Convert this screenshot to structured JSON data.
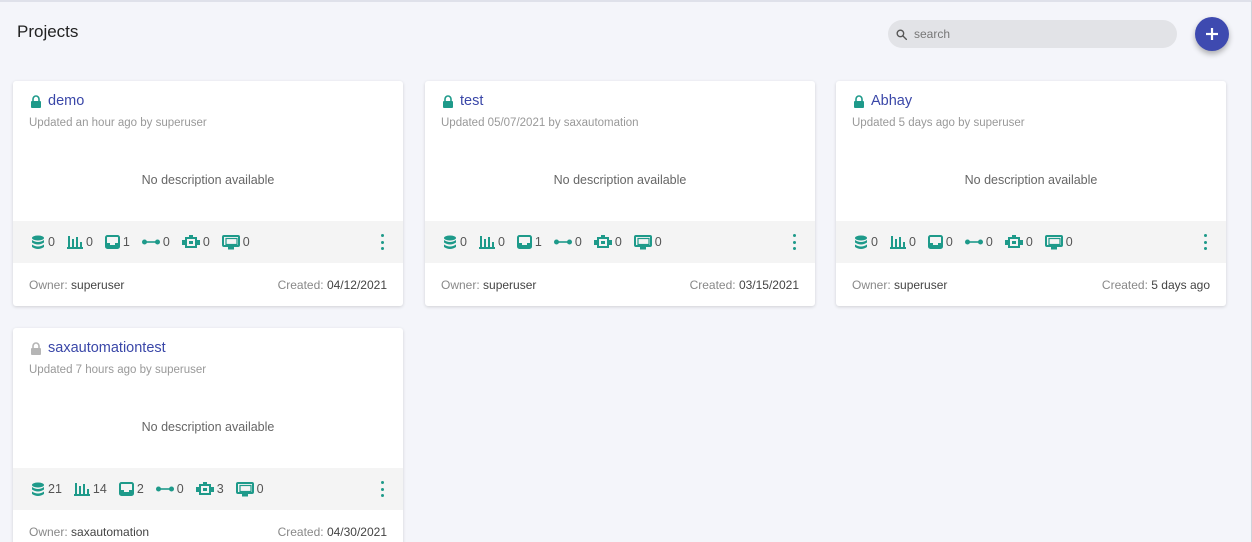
{
  "header": {
    "title": "Projects",
    "search_placeholder": "search"
  },
  "colors": {
    "accent": "#1e9a8a",
    "link": "#3a47a8",
    "add_button": "#3e4ab0",
    "lock_locked": "#1e9a8a",
    "lock_unlocked": "#b5b5b5"
  },
  "labels": {
    "no_description": "No description available",
    "owner": "Owner:",
    "created": "Created:"
  },
  "projects": [
    {
      "name": "demo",
      "lock": "locked",
      "updated": "Updated an hour ago by superuser",
      "description": "No description available",
      "stats": {
        "datasets": "0",
        "charts": "0",
        "inbox": "1",
        "pipelines": "0",
        "engines": "0",
        "dashboards": "0"
      },
      "owner": "superuser",
      "created": "04/12/2021"
    },
    {
      "name": "test",
      "lock": "locked",
      "updated": "Updated 05/07/2021 by saxautomation",
      "description": "No description available",
      "stats": {
        "datasets": "0",
        "charts": "0",
        "inbox": "1",
        "pipelines": "0",
        "engines": "0",
        "dashboards": "0"
      },
      "owner": "superuser",
      "created": "03/15/2021"
    },
    {
      "name": "Abhay",
      "lock": "locked",
      "updated": "Updated 5 days ago by superuser",
      "description": "No description available",
      "stats": {
        "datasets": "0",
        "charts": "0",
        "inbox": "0",
        "pipelines": "0",
        "engines": "0",
        "dashboards": "0"
      },
      "owner": "superuser",
      "created": "5 days ago"
    },
    {
      "name": "saxautomationtest",
      "lock": "unlocked",
      "updated": "Updated 7 hours ago by superuser",
      "description": "No description available",
      "stats": {
        "datasets": "21",
        "charts": "14",
        "inbox": "2",
        "pipelines": "0",
        "engines": "3",
        "dashboards": "0"
      },
      "owner": "saxautomation",
      "created": "04/30/2021"
    }
  ]
}
